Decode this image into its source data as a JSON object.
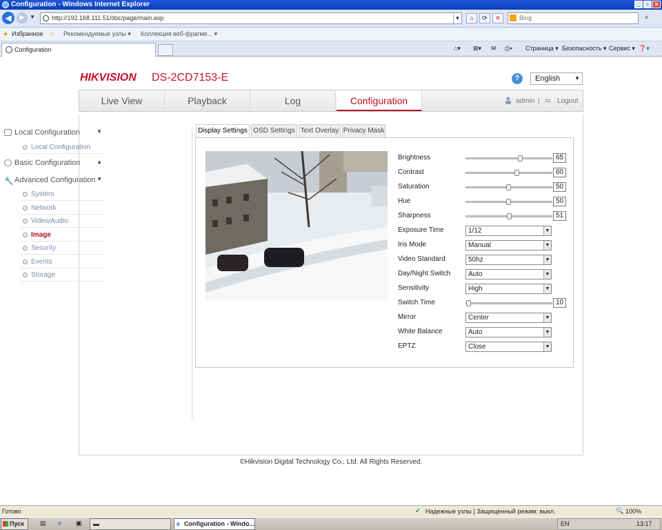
{
  "browser": {
    "window_title": "Configuration - Windows Internet Explorer",
    "url": "http://192.168.111.51/doc/page/main.asp",
    "search_placeholder": "Bing",
    "favorites_label": "Избранное",
    "fav_links": [
      "Рекомендуемые узлы ▾",
      "Коллекция веб-фрагме... ▾"
    ],
    "tab_title": "Configuration",
    "commands": [
      "Страница ▾",
      "Безопасность ▾",
      "Сервис ▾"
    ]
  },
  "header": {
    "logo": "HIKVISION",
    "model": "DS-2CD7153-E",
    "help_icon": "?",
    "language": "English"
  },
  "menu": {
    "tabs": [
      "Live View",
      "Playback",
      "Log",
      "Configuration"
    ],
    "active": "Configuration",
    "user": "admin",
    "separator": "|",
    "logout": "Logout"
  },
  "sidebar": {
    "local": {
      "title": "Local Configuration",
      "items": [
        "Local Configuration"
      ]
    },
    "basic": {
      "title": "Basic Configuration"
    },
    "advanced": {
      "title": "Advanced Configuration",
      "items": [
        "System",
        "Network",
        "Video/Audio",
        "Image",
        "Security",
        "Events",
        "Storage"
      ],
      "active": "Image"
    }
  },
  "content_tabs": [
    "Display Settings",
    "OSD Settings",
    "Text Overlay",
    "Privacy Mask"
  ],
  "settings": {
    "brightness": {
      "label": "Brightness",
      "value": 65
    },
    "contrast": {
      "label": "Contrast",
      "value": 60
    },
    "saturation": {
      "label": "Saturation",
      "value": 50
    },
    "hue": {
      "label": "Hue",
      "value": 50
    },
    "sharpness": {
      "label": "Sharpness",
      "value": 51
    },
    "exposure": {
      "label": "Exposure Time",
      "value": "1/12"
    },
    "iris": {
      "label": "Iris Mode",
      "value": "Manual"
    },
    "standard": {
      "label": "Video Standard",
      "value": "50hz"
    },
    "daynight": {
      "label": "Day/Night Switch",
      "value": "Auto"
    },
    "sensitivity": {
      "label": "Sensitivity",
      "value": "High"
    },
    "switch_time": {
      "label": "Switch Time",
      "value": 10
    },
    "mirror": {
      "label": "Mirror",
      "value": "Center"
    },
    "wb": {
      "label": "White Balance",
      "value": "Auto"
    },
    "eptz": {
      "label": "EPTZ",
      "value": "Close"
    }
  },
  "footer": "©Hikvision Digital Technology Co., Ltd. All Rights Reserved.",
  "statusbar": {
    "left": "Готово",
    "zone": "Надежные узлы | Защищенный режим: выкл.",
    "zoom": "100%"
  },
  "taskbar": {
    "start": "Пуск",
    "window": "Configuration - Windo...",
    "lang": "EN",
    "clock": "13:17"
  }
}
